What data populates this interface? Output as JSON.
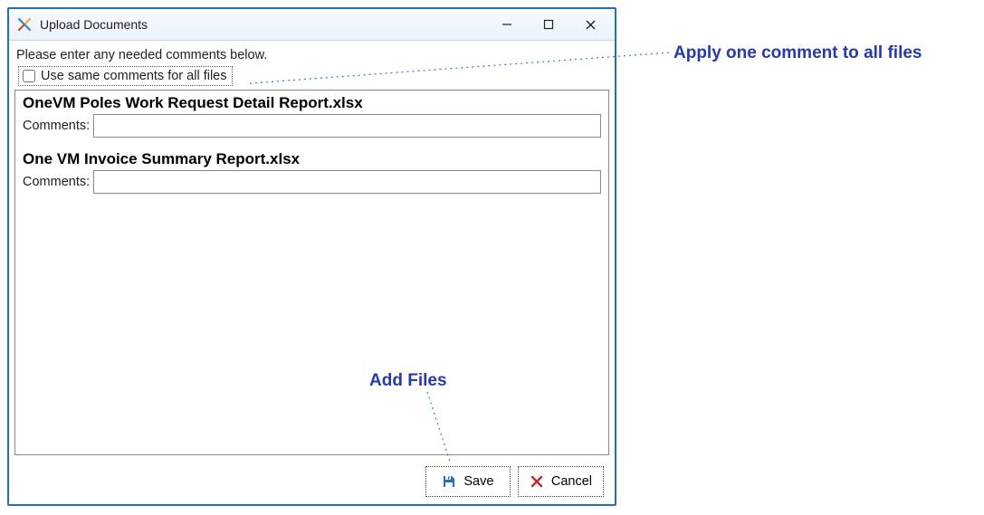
{
  "window": {
    "title": "Upload Documents"
  },
  "prompt": "Please enter any needed comments below.",
  "checkbox": {
    "label": "Use same comments for all files"
  },
  "files": [
    {
      "name": "OneVM Poles Work Request Detail Report.xlsx",
      "comments_label": "Comments:",
      "comments_value": ""
    },
    {
      "name": "One VM Invoice Summary Report.xlsx",
      "comments_label": "Comments:",
      "comments_value": ""
    }
  ],
  "buttons": {
    "save": "Save",
    "cancel": "Cancel"
  },
  "annotations": {
    "apply_all": "Apply one comment to all files",
    "add_files": "Add Files"
  }
}
